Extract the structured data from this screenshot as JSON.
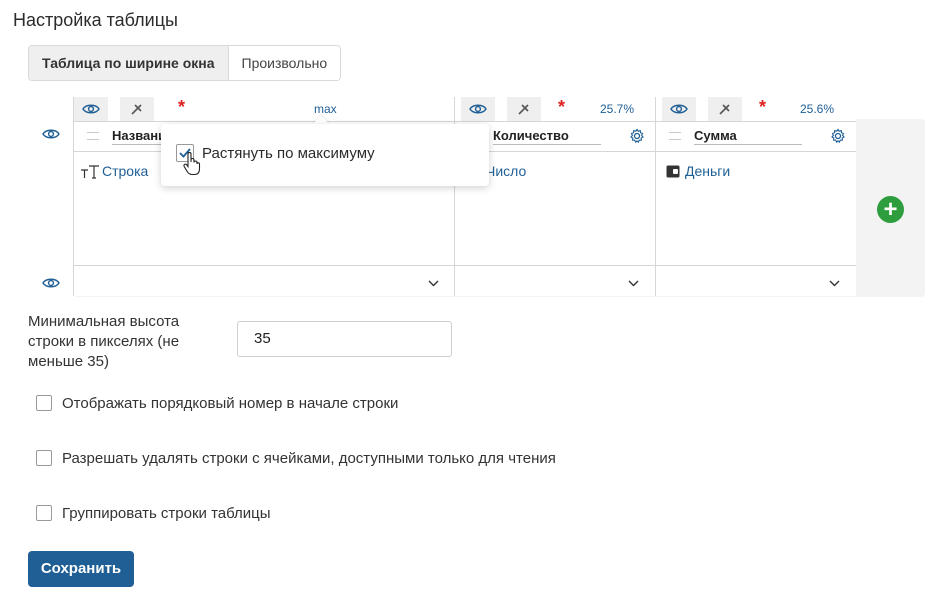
{
  "page": {
    "title": "Настройка таблицы"
  },
  "width_mode": {
    "options": [
      "Таблица по ширине окна",
      "Произвольно"
    ],
    "selected": "Таблица по ширине окна"
  },
  "columns": [
    {
      "width_label": "max",
      "name": "Названи",
      "type_label": "Строка",
      "type_icon": "text-type-icon"
    },
    {
      "width_label": "25.7%",
      "name": "Количество",
      "type_label": "Число",
      "type_icon": "number-type-icon"
    },
    {
      "width_label": "25.6%",
      "name": "Сумма",
      "type_label": "Деньги",
      "type_icon": "money-type-icon"
    }
  ],
  "popup": {
    "label": "Растянуть по максимуму",
    "checked": true
  },
  "min_height": {
    "label": "Минимальная высота строки в пикселях (не меньше 35)",
    "value": "35"
  },
  "options": [
    {
      "label": "Отображать порядковый номер в начале строки",
      "checked": false
    },
    {
      "label": "Разрешать удалять строки с ячейками, доступными только для чтения",
      "checked": false
    },
    {
      "label": "Группировать строки таблицы",
      "checked": false
    }
  ],
  "actions": {
    "save_label": "Сохранить"
  },
  "colors": {
    "accent": "#1f5f96",
    "add": "#2e9d3e",
    "required": "#e02020"
  }
}
